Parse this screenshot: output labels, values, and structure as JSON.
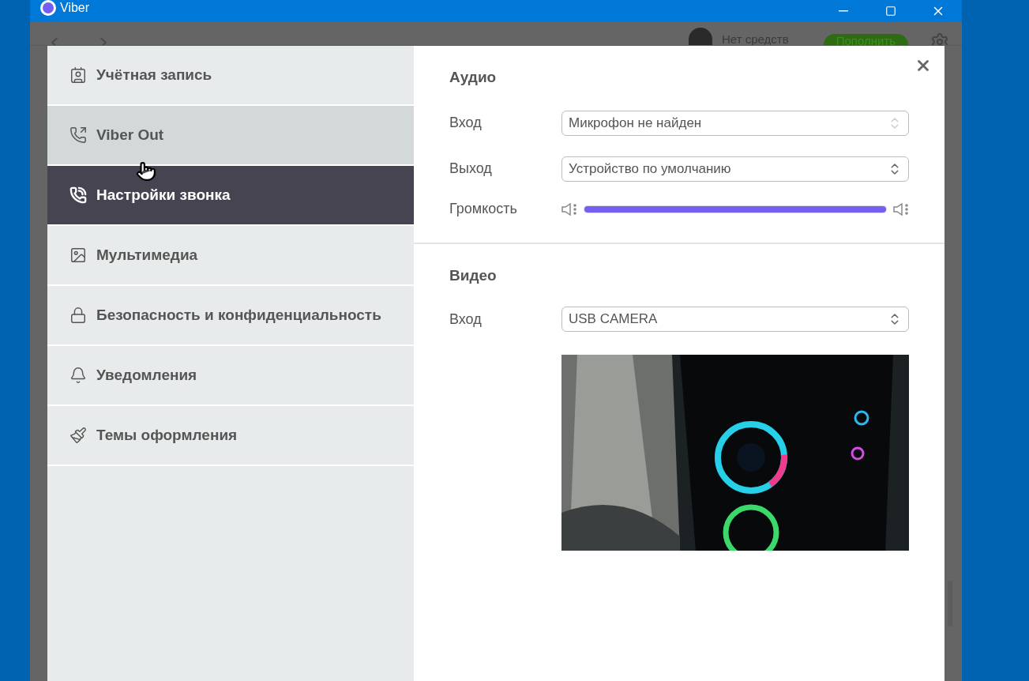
{
  "window": {
    "title": "Viber"
  },
  "background_toolbar": {
    "balance": "Нет средств",
    "top_up_button": "Пополнить"
  },
  "settings": {
    "sidebar": {
      "items": [
        {
          "kind": "account",
          "label": "Учётная запись",
          "selected": false,
          "hovered": false
        },
        {
          "kind": "viber-out",
          "label": "Viber Out",
          "selected": false,
          "hovered": true
        },
        {
          "kind": "calls",
          "label": "Настройки звонка",
          "selected": true,
          "hovered": false
        },
        {
          "kind": "media",
          "label": "Мультимедиа",
          "selected": false,
          "hovered": false
        },
        {
          "kind": "privacy",
          "label": "Безопасность и конфиденциальность",
          "selected": false,
          "hovered": false
        },
        {
          "kind": "notifications",
          "label": "Уведомления",
          "selected": false,
          "hovered": false
        },
        {
          "kind": "themes",
          "label": "Темы оформления",
          "selected": false,
          "hovered": false
        }
      ]
    },
    "audio": {
      "title": "Аудио",
      "input": {
        "label": "Вход",
        "value": "Микрофон не найден",
        "disabled": true
      },
      "output": {
        "label": "Выход",
        "value": "Устройство по умолчанию",
        "disabled": false
      },
      "volume": {
        "label": "Громкость",
        "level": 1.0
      }
    },
    "video": {
      "title": "Видео",
      "input": {
        "label": "Вход",
        "value": "USB CAMERA",
        "disabled": false
      }
    }
  }
}
